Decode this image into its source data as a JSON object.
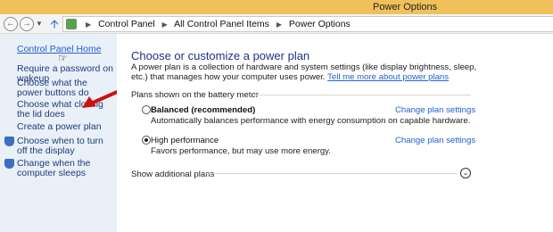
{
  "window": {
    "title": "Power Options"
  },
  "address": {
    "crumbs": [
      "Control Panel",
      "All Control Panel Items",
      "Power Options"
    ]
  },
  "sidebar": {
    "home": "Control Panel Home",
    "links": [
      {
        "label": "Require a password on wakeup",
        "icon": ""
      },
      {
        "label": "Choose what the power buttons do",
        "icon": ""
      },
      {
        "label": "Choose what closing the lid does",
        "icon": ""
      },
      {
        "label": "Create a power plan",
        "icon": ""
      },
      {
        "label": "Choose when to turn off the display",
        "icon": "shield-icon"
      },
      {
        "label": "Change when the computer sleeps",
        "icon": "shield-icon"
      }
    ]
  },
  "main": {
    "heading": "Choose or customize a power plan",
    "intro": "A power plan is a collection of hardware and system settings (like display brightness, sleep, etc.) that manages how your computer uses power.",
    "intro_link": "Tell me more about power plans",
    "section_label": "Plans shown on the battery meter",
    "plans": [
      {
        "name": "Balanced (recommended)",
        "description": "Automatically balances performance with energy consumption on capable hardware.",
        "selected": false,
        "change_label": "Change plan settings"
      },
      {
        "name": "High performance",
        "description": "Favors performance, but may use more energy.",
        "selected": true,
        "change_label": "Change plan settings"
      }
    ],
    "show_more": "Show additional plans"
  },
  "colors": {
    "titlebar": "#f0c15a",
    "sidebar": "#eaf0f8",
    "link": "#1f5fd4",
    "heading": "#1e3287",
    "annotation_arrow": "#cc1111"
  }
}
